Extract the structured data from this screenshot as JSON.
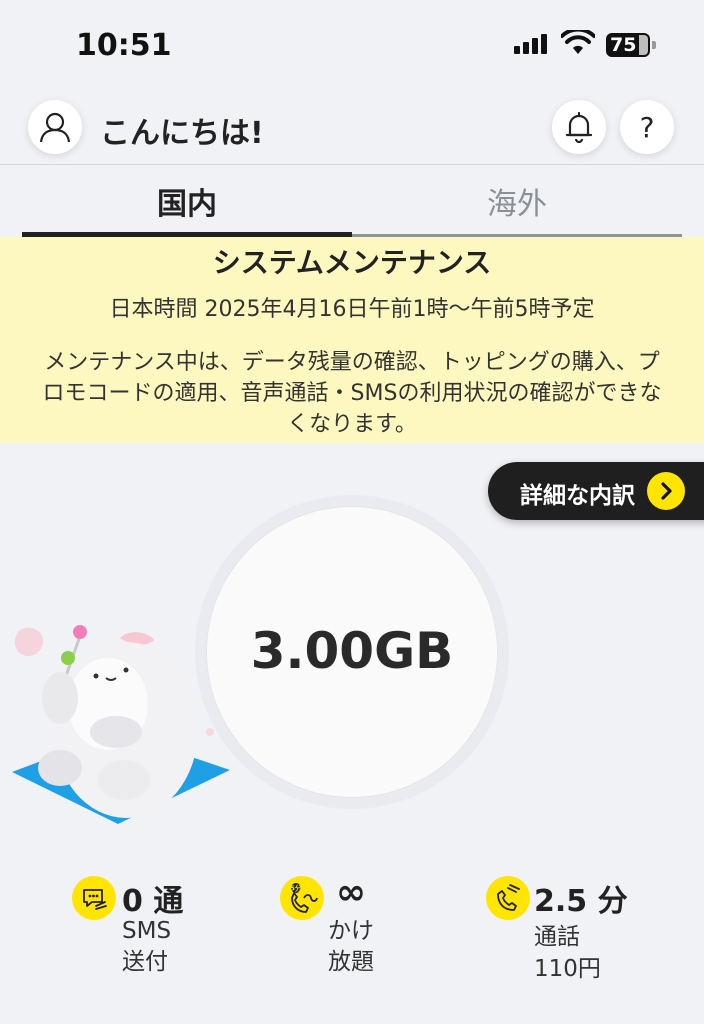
{
  "status_bar": {
    "time": "10:51",
    "battery": "75"
  },
  "header": {
    "greeting": "こんにちは!",
    "help": "?"
  },
  "tabs": [
    {
      "label": "国内"
    },
    {
      "label": "海外"
    }
  ],
  "maintenance": {
    "title": "システムメンテナンス",
    "schedule": "日本時間 2025年4月16日午前1時〜午前5時予定",
    "body": "メンテナンス中は、データ残量の確認、トッピングの購入、プロモコードの適用、音声通話・SMSの利用状況の確認ができなくなります。"
  },
  "details_button": {
    "label": "詳細な内訳"
  },
  "data_remaining": {
    "amount": "3.00GB"
  },
  "stats": {
    "sms": {
      "value": "0 通",
      "label_line1": "SMS",
      "label_line2": "送付"
    },
    "calls_unlimited": {
      "value": "∞",
      "badge": "5分",
      "label_line1": "かけ",
      "label_line2": "放題"
    },
    "call_time": {
      "value": "2.5 分",
      "label_line1": "通話",
      "label_line2": "110円"
    }
  },
  "colors": {
    "accent": "#ffe500",
    "banner": "#fdf8bf",
    "dark": "#1f1f1f"
  }
}
